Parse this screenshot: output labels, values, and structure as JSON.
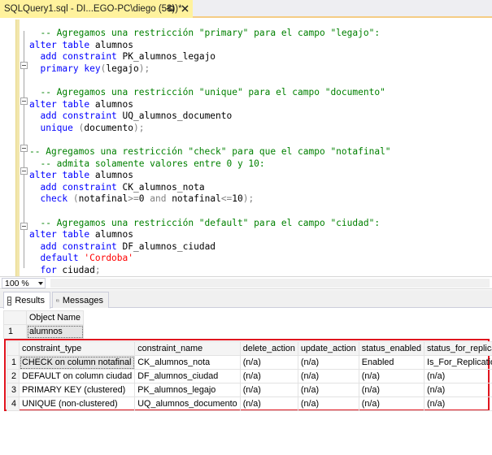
{
  "tab": {
    "title": "SQLQuery1.sql - DI...EGO-PC\\diego (58))*"
  },
  "editor": {
    "lines": [
      [
        {
          "t": "  -- Agregamos una restricción \"primary\" para el campo \"legajo\":",
          "c": "cm"
        }
      ],
      [
        {
          "t": "alter",
          "c": "kw"
        },
        {
          "t": " ",
          "c": "id"
        },
        {
          "t": "table",
          "c": "kw"
        },
        {
          "t": " alumnos",
          "c": "id"
        }
      ],
      [
        {
          "t": "  add",
          "c": "kw"
        },
        {
          "t": " ",
          "c": "id"
        },
        {
          "t": "constraint",
          "c": "kw"
        },
        {
          "t": " PK_alumnos_legajo",
          "c": "id"
        }
      ],
      [
        {
          "t": "  primary",
          "c": "kw"
        },
        {
          "t": " ",
          "c": "id"
        },
        {
          "t": "key",
          "c": "kw"
        },
        {
          "t": "(",
          "c": "op"
        },
        {
          "t": "legajo",
          "c": "id"
        },
        {
          "t": ");",
          "c": "op"
        }
      ],
      [
        {
          "t": "",
          "c": "id"
        }
      ],
      [
        {
          "t": "  -- Agregamos una restricción \"unique\" para el campo \"documento\"",
          "c": "cm"
        }
      ],
      [
        {
          "t": "alter",
          "c": "kw"
        },
        {
          "t": " ",
          "c": "id"
        },
        {
          "t": "table",
          "c": "kw"
        },
        {
          "t": " alumnos",
          "c": "id"
        }
      ],
      [
        {
          "t": "  add",
          "c": "kw"
        },
        {
          "t": " ",
          "c": "id"
        },
        {
          "t": "constraint",
          "c": "kw"
        },
        {
          "t": " UQ_alumnos_documento",
          "c": "id"
        }
      ],
      [
        {
          "t": "  unique",
          "c": "kw"
        },
        {
          "t": " (",
          "c": "op"
        },
        {
          "t": "documento",
          "c": "id"
        },
        {
          "t": ");",
          "c": "op"
        }
      ],
      [
        {
          "t": "",
          "c": "id"
        }
      ],
      [
        {
          "t": "-- Agregamos una restricción \"check\" para que el campo \"notafinal\"",
          "c": "cm"
        }
      ],
      [
        {
          "t": "  -- admita solamente valores entre 0 y 10:",
          "c": "cm"
        }
      ],
      [
        {
          "t": "alter",
          "c": "kw"
        },
        {
          "t": " ",
          "c": "id"
        },
        {
          "t": "table",
          "c": "kw"
        },
        {
          "t": " alumnos",
          "c": "id"
        }
      ],
      [
        {
          "t": "  add",
          "c": "kw"
        },
        {
          "t": " ",
          "c": "id"
        },
        {
          "t": "constraint",
          "c": "kw"
        },
        {
          "t": " CK_alumnos_nota",
          "c": "id"
        }
      ],
      [
        {
          "t": "  check",
          "c": "kw"
        },
        {
          "t": " (",
          "c": "op"
        },
        {
          "t": "notafinal",
          "c": "id"
        },
        {
          "t": ">=",
          "c": "op"
        },
        {
          "t": "0 ",
          "c": "id"
        },
        {
          "t": "and",
          "c": "op"
        },
        {
          "t": " notafinal",
          "c": "id"
        },
        {
          "t": "<=",
          "c": "op"
        },
        {
          "t": "10",
          "c": "id"
        },
        {
          "t": ");",
          "c": "op"
        }
      ],
      [
        {
          "t": "",
          "c": "id"
        }
      ],
      [
        {
          "t": "  -- Agregamos una restricción \"default\" para el campo \"ciudad\":",
          "c": "cm"
        }
      ],
      [
        {
          "t": "alter",
          "c": "kw"
        },
        {
          "t": " ",
          "c": "id"
        },
        {
          "t": "table",
          "c": "kw"
        },
        {
          "t": " alumnos",
          "c": "id"
        }
      ],
      [
        {
          "t": "  add",
          "c": "kw"
        },
        {
          "t": " ",
          "c": "id"
        },
        {
          "t": "constraint",
          "c": "kw"
        },
        {
          "t": " DF_alumnos_ciudad",
          "c": "id"
        }
      ],
      [
        {
          "t": "  default",
          "c": "kw"
        },
        {
          "t": " ",
          "c": "id"
        },
        {
          "t": "'Cordoba'",
          "c": "str"
        }
      ],
      [
        {
          "t": "  for",
          "c": "kw"
        },
        {
          "t": " ciudad",
          "c": "id"
        },
        {
          "t": ";",
          "c": "op"
        }
      ]
    ]
  },
  "zoom": {
    "value": "100 %"
  },
  "results_tabs": {
    "results_label": "Results",
    "messages_label": "Messages"
  },
  "result1": {
    "columns": [
      "Object Name"
    ],
    "rows": [
      {
        "num": "1",
        "cells": [
          "alumnos"
        ]
      }
    ]
  },
  "result2": {
    "columns": [
      "constraint_type",
      "constraint_name",
      "delete_action",
      "update_action",
      "status_enabled",
      "status_for_replication"
    ],
    "rows": [
      {
        "num": "1",
        "cells": [
          "CHECK on column notafinal",
          "CK_alumnos_nota",
          "(n/a)",
          "(n/a)",
          "Enabled",
          "Is_For_Replication"
        ]
      },
      {
        "num": "2",
        "cells": [
          "DEFAULT on column ciudad",
          "DF_alumnos_ciudad",
          "(n/a)",
          "(n/a)",
          "(n/a)",
          "(n/a)"
        ]
      },
      {
        "num": "3",
        "cells": [
          "PRIMARY KEY (clustered)",
          "PK_alumnos_legajo",
          "(n/a)",
          "(n/a)",
          "(n/a)",
          "(n/a)"
        ]
      },
      {
        "num": "4",
        "cells": [
          "UNIQUE (non-clustered)",
          "UQ_alumnos_documento",
          "(n/a)",
          "(n/a)",
          "(n/a)",
          "(n/a)"
        ]
      }
    ]
  }
}
